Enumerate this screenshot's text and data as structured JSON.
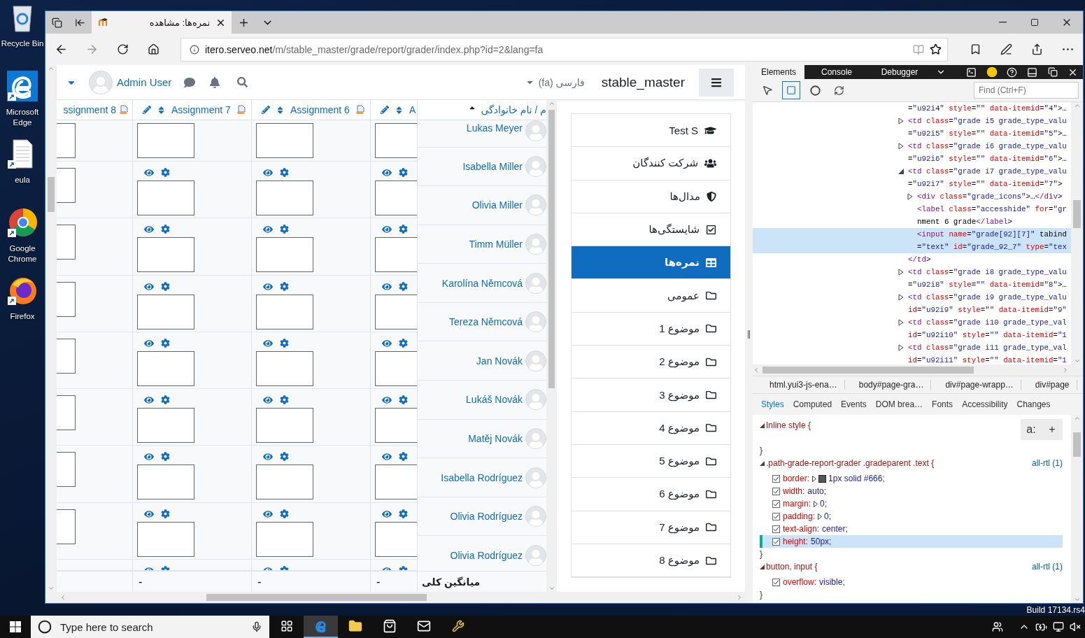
{
  "desktop": {
    "icons": [
      {
        "label": "Recycle Bin",
        "kind": "recycle"
      },
      {
        "label": "Microsoft Edge",
        "kind": "edge"
      },
      {
        "label": "eula",
        "kind": "document"
      },
      {
        "label": "Google Chrome",
        "kind": "chrome"
      },
      {
        "label": "Firefox",
        "kind": "firefox"
      }
    ],
    "build": "Build 17134.rs4"
  },
  "browser": {
    "tab": {
      "title": "نمره‌ها: مشاهده"
    },
    "address": {
      "host": "itero.serveo.net",
      "path": "/m/stable_master/grade/report/grader/index.php?id=2&lang=fa"
    }
  },
  "page": {
    "header": {
      "user": "Admin User",
      "language": "فارسی (fa)",
      "site": "stable_master"
    },
    "grader": {
      "columns": [
        {
          "label": "ssignment 8",
          "kind": "cut-left"
        },
        {
          "label": "Assignment 7",
          "kind": "full",
          "average": "-"
        },
        {
          "label": "Assignment 6",
          "kind": "full",
          "average": "-"
        },
        {
          "label": "A",
          "kind": "cut-right",
          "average": "-"
        }
      ],
      "grade_rows": [
        {
          "kind": "cut-top"
        },
        {
          "kind": "full"
        },
        {
          "kind": "full"
        },
        {
          "kind": "full"
        },
        {
          "kind": "full"
        },
        {
          "kind": "full"
        },
        {
          "kind": "full"
        },
        {
          "kind": "full"
        },
        {
          "kind": "cut-bottom"
        }
      ],
      "name_header": "م / نام خانوادگی",
      "students": [
        {
          "name": "Lukas Meyer",
          "kind": "cut-top"
        },
        {
          "name": "Isabella Miller",
          "kind": "full"
        },
        {
          "name": "Olivia Miller",
          "kind": "full"
        },
        {
          "name": "Timm Müller",
          "kind": "full"
        },
        {
          "name": "Karolína Němcová",
          "kind": "full"
        },
        {
          "name": "Tereza Němcová",
          "kind": "full"
        },
        {
          "name": "Jan Novák",
          "kind": "full"
        },
        {
          "name": "Lukáš Novák",
          "kind": "full"
        },
        {
          "name": "Matěj Novák",
          "kind": "full"
        },
        {
          "name": "Isabella Rodríguez",
          "kind": "full"
        },
        {
          "name": "Olivia Rodríguez",
          "kind": "full"
        },
        {
          "name": "Olivia Rodríguez",
          "kind": "full"
        }
      ],
      "average_label": "میانگین کلی"
    },
    "nav": [
      {
        "label": "Test S",
        "kind": "course",
        "selected": false
      },
      {
        "label": "شرکت کنندگان",
        "kind": "participants",
        "selected": false
      },
      {
        "label": "مدال‌ها",
        "kind": "badges",
        "selected": false
      },
      {
        "label": "شایستگی‌ها",
        "kind": "competencies",
        "selected": false
      },
      {
        "label": "نمره‌ها",
        "kind": "grades",
        "selected": true
      },
      {
        "label": "عمومی",
        "kind": "section",
        "selected": false
      },
      {
        "label": "موضوع 1",
        "kind": "section",
        "selected": false
      },
      {
        "label": "موضوع 2",
        "kind": "section",
        "selected": false
      },
      {
        "label": "موضوع 3",
        "kind": "section",
        "selected": false
      },
      {
        "label": "موضوع 4",
        "kind": "section",
        "selected": false
      },
      {
        "label": "موضوع 5",
        "kind": "section",
        "selected": false
      },
      {
        "label": "موضوع 6",
        "kind": "section",
        "selected": false
      },
      {
        "label": "موضوع 7",
        "kind": "section",
        "selected": false
      },
      {
        "label": "موضوع 8",
        "kind": "section",
        "selected": false
      }
    ]
  },
  "devtools": {
    "tabs": [
      {
        "label": "Elements",
        "selected": true
      },
      {
        "label": "Console",
        "selected": false
      },
      {
        "label": "Debugger",
        "selected": false
      }
    ],
    "tools": [
      {
        "kind": "pick",
        "selected": false
      },
      {
        "kind": "highlight",
        "selected": true
      },
      {
        "kind": "paint",
        "selected": false
      },
      {
        "kind": "refresh",
        "selected": false
      }
    ],
    "find_placeholder": "Find (Ctrl+F)",
    "dom_tree": [
      {
        "lines": [
          "=\"u92i4\" style=\"\" data-itemid=\"4\">…"
        ],
        "kind": "leaf",
        "selected": false
      },
      {
        "lines": [
          "<td class=\"grade i5 grade_type_valu",
          "=\"u92i5\" style=\"\" data-itemid=\"5\">…"
        ],
        "kind": "collapsed",
        "selected": false
      },
      {
        "lines": [
          "<td class=\"grade i6 grade_type_valu",
          "=\"u92i6\" style=\"\" data-itemid=\"6\">…"
        ],
        "kind": "collapsed",
        "selected": false
      },
      {
        "lines": [
          "<td class=\"grade i7 grade_type_valu",
          "=\"u92i7\" style=\"\" data-itemid=\"7\">"
        ],
        "kind": "expanded",
        "selected": false,
        "closing": "</td>",
        "children": [
          {
            "lines": [
              "<div class=\"grade_icons\">…</div>"
            ],
            "kind": "collapsed",
            "selected": false
          },
          {
            "lines": [
              "<label class=\"accesshide\" for=\"gr",
              "nment 6 grade</label>"
            ],
            "kind": "leaf",
            "selected": false
          },
          {
            "lines": [
              "<input name=\"grade[92][7]\" tabind",
              "=\"text\" id=\"grade_92_7\" type=\"tex"
            ],
            "kind": "leaf",
            "selected": true
          }
        ]
      },
      {
        "lines": [
          "<td class=\"grade i8 grade_type_valu",
          "=\"u92i8\" style=\"\" data-itemid=\"8\">…"
        ],
        "kind": "collapsed",
        "selected": false
      },
      {
        "lines": [
          "<td class=\"grade i9 grade_type_valu",
          "id=\"u92i9\" style=\"\" data-itemid=\"9\""
        ],
        "kind": "collapsed",
        "selected": false
      },
      {
        "lines": [
          "<td class=\"grade i10 grade_type_val",
          "id=\"u92i10\" style=\"\" data-itemid=\"1"
        ],
        "kind": "collapsed",
        "selected": false
      },
      {
        "lines": [
          "<td class=\"grade i11 grade_type_val",
          "id=\"u92i11\" style=\"\" data-itemid=\"1"
        ],
        "kind": "collapsed",
        "selected": false
      }
    ],
    "breadcrumbs": [
      "html.yui3-js-ena…",
      "body#page-gra…",
      "div#page-wrapp…",
      "div#page"
    ],
    "panel_tabs": [
      {
        "label": "Styles",
        "selected": true
      },
      {
        "label": "Computed",
        "selected": false
      },
      {
        "label": "Events",
        "selected": false
      },
      {
        "label": "DOM brea…",
        "selected": false
      },
      {
        "label": "Fonts",
        "selected": false
      },
      {
        "label": "Accessibility",
        "selected": false
      },
      {
        "label": "Changes",
        "selected": false
      }
    ],
    "rules": [
      {
        "selector": "Inline style",
        "kind": "inline",
        "open": "{",
        "close": "}",
        "actions": [
          "a:",
          "+"
        ]
      },
      {
        "selector": ".path-grade-report-grader .gradeparent .text",
        "kind": "sheet",
        "open": "{",
        "close": "}",
        "source": "all-rtl (1)",
        "properties": [
          {
            "name": "border:",
            "value": "1px solid #666;",
            "kind": "color",
            "checked": true,
            "selected": false
          },
          {
            "name": "width:",
            "value": "auto;",
            "kind": "plain",
            "checked": true,
            "selected": false
          },
          {
            "name": "margin:",
            "value": "0;",
            "kind": "shorthand",
            "checked": true,
            "selected": false
          },
          {
            "name": "padding:",
            "value": "0;",
            "kind": "shorthand",
            "checked": true,
            "selected": false
          },
          {
            "name": "text-align:",
            "value": "center;",
            "kind": "plain",
            "checked": true,
            "selected": false
          },
          {
            "name": "height:",
            "value": "50px;",
            "kind": "plain",
            "checked": true,
            "selected": true
          }
        ]
      },
      {
        "selector": "button, input",
        "kind": "sheet",
        "open": "{",
        "close": "}",
        "source": "all-rtl (1)",
        "properties": [
          {
            "name": "overflow:",
            "value": "visible;",
            "kind": "plain",
            "checked": true,
            "selected": false
          }
        ]
      }
    ]
  },
  "taskbar": {
    "search_placeholder": "Type here to search",
    "apps": [
      {
        "kind": "task-view",
        "selected": false
      },
      {
        "kind": "edge",
        "selected": true
      },
      {
        "kind": "explorer",
        "selected": false
      },
      {
        "kind": "store",
        "selected": false
      },
      {
        "kind": "mail",
        "selected": false
      },
      {
        "kind": "tool",
        "selected": false
      }
    ]
  }
}
